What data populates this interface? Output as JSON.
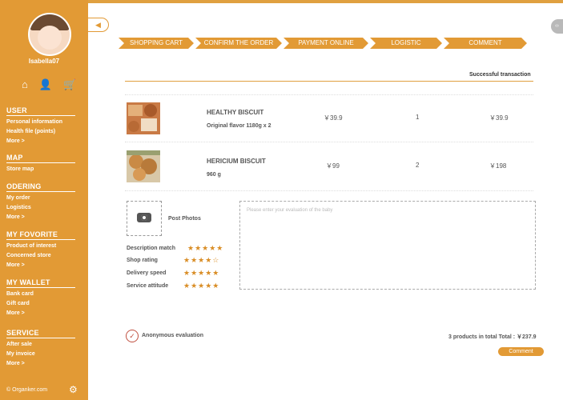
{
  "user": {
    "name": "Isabella07"
  },
  "quick_icons": [
    "home-icon",
    "user-icon",
    "cart-icon"
  ],
  "sidebar": {
    "sections": [
      {
        "title": "USER",
        "items": [
          "Personal information",
          "Health file (points)",
          "More >"
        ]
      },
      {
        "title": "MAP",
        "items": [
          "Store map"
        ]
      },
      {
        "title": "ODERING",
        "items": [
          "My order",
          "Logistics",
          "More >"
        ]
      },
      {
        "title": "MY FOVORITE",
        "items": [
          "Product of interest",
          "Concerned store",
          "More >"
        ]
      },
      {
        "title": "MY WALLET",
        "items": [
          "Bank card",
          "Gift card",
          "More >"
        ]
      },
      {
        "title": "SERVICE",
        "items": [
          "After sale",
          "My invoice",
          "More >"
        ]
      }
    ],
    "footer": "© Organker.com"
  },
  "steps": [
    "SHOPPING CART",
    "CONFIRM THE ORDER",
    "PAYMENT ONLINE",
    "LOGISTIC",
    "COMMENT"
  ],
  "status": "Successful transaction",
  "products": [
    {
      "name": "HEALTHY BISCUIT",
      "spec": "Original flavor 1180g x 2",
      "price": "￥39.9",
      "qty": "1",
      "subtotal": "￥39.9"
    },
    {
      "name": "HERICIUM BISCUIT",
      "spec": "960 g",
      "price": "￥99",
      "qty": "2",
      "subtotal": "￥198"
    }
  ],
  "post_photos": "Post Photos",
  "ratings": [
    {
      "label": "Description match",
      "stars": 5
    },
    {
      "label": "Shop rating",
      "stars": 4
    },
    {
      "label": "Delivery speed",
      "stars": 5
    },
    {
      "label": "Service attitude",
      "stars": 5
    }
  ],
  "evaluation_placeholder": "Please enter your evaluation of the baby",
  "anonymous_label": "Anonymous evaluation",
  "total_text": "3 products in total  Total : ￥237.9",
  "comment_button": "Comment",
  "colors": {
    "accent": "#e29a35"
  }
}
